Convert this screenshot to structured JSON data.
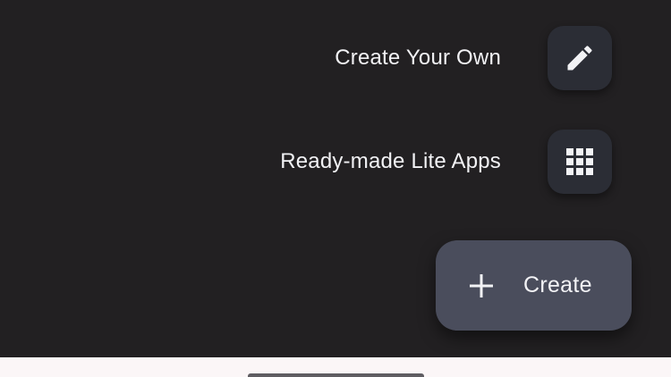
{
  "speed_dial": {
    "items": [
      {
        "label": "Create Your Own",
        "icon": "pencil-icon"
      },
      {
        "label": "Ready-made Lite Apps",
        "icon": "grid-icon"
      }
    ],
    "main_button": {
      "label": "Create",
      "icon": "plus-icon"
    }
  },
  "colors": {
    "overlay_background": "#222022",
    "mini_fab_background": "#2b2d35",
    "main_fab_background": "#4a4d5c",
    "text": "#f2f2f5",
    "bottom_bar": "#fbf6f7"
  }
}
